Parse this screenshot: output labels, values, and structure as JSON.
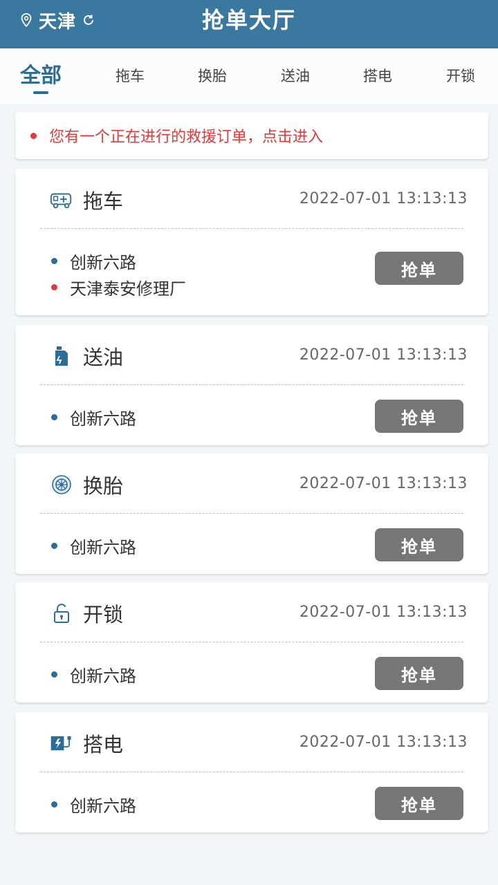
{
  "header": {
    "city": "天津",
    "title": "抢单大厅"
  },
  "tabs": [
    "全部",
    "拖车",
    "换胎",
    "送油",
    "搭电",
    "开锁"
  ],
  "notice": {
    "text": "您有一个正在进行的救援订单，点击进入"
  },
  "grab_label": "抢单",
  "orders": [
    {
      "type": "拖车",
      "icon": "tow-truck-icon",
      "time": "2022-07-01   13:13:13",
      "start": "创新六路",
      "end": "天津泰安修理厂"
    },
    {
      "type": "送油",
      "icon": "fuel-can-icon",
      "time": "2022-07-01   13:13:13",
      "start": "创新六路"
    },
    {
      "type": "换胎",
      "icon": "tire-icon",
      "time": "2022-07-01   13:13:13",
      "start": "创新六路"
    },
    {
      "type": "开锁",
      "icon": "unlock-icon",
      "time": "2022-07-01   13:13:13",
      "start": "创新六路"
    },
    {
      "type": "搭电",
      "icon": "battery-charge-icon",
      "time": "2022-07-01   13:13:13",
      "start": "创新六路"
    }
  ],
  "colors": {
    "header": "#3a78a0",
    "accent": "#2c6d98",
    "alert": "#e03a3a",
    "button": "#767676"
  }
}
